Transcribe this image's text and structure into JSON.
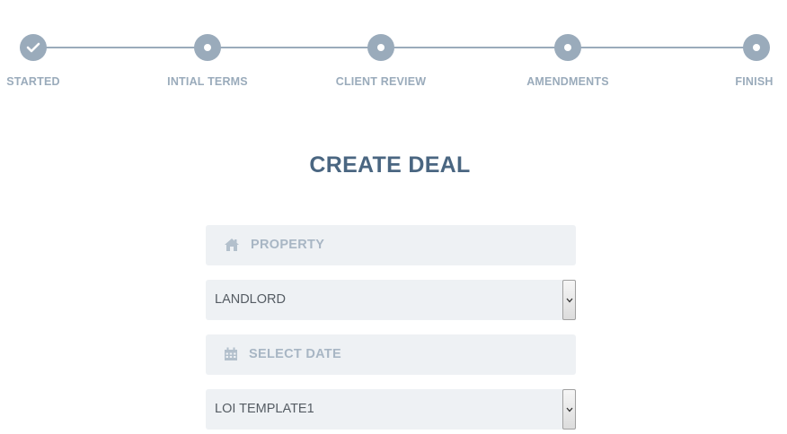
{
  "progress": {
    "steps": [
      {
        "label": "STARTED",
        "state": "completed"
      },
      {
        "label": "INTIAL TERMS",
        "state": "pending"
      },
      {
        "label": "CLIENT REVIEW",
        "state": "pending"
      },
      {
        "label": "AMENDMENTS",
        "state": "pending"
      },
      {
        "label": "FINISH",
        "state": "pending"
      }
    ]
  },
  "page": {
    "title": "CREATE DEAL"
  },
  "form": {
    "property": {
      "placeholder": "PROPERTY",
      "icon": "home-icon"
    },
    "landlord": {
      "value": "LANDLORD"
    },
    "date": {
      "placeholder": "SELECT DATE",
      "icon": "calendar-icon"
    },
    "template": {
      "value": "LOI TEMPLATE1"
    }
  },
  "colors": {
    "step_accent": "#9aabbb",
    "title": "#4a6681",
    "field_bg": "#eef1f4",
    "placeholder": "#a8b6c4"
  }
}
